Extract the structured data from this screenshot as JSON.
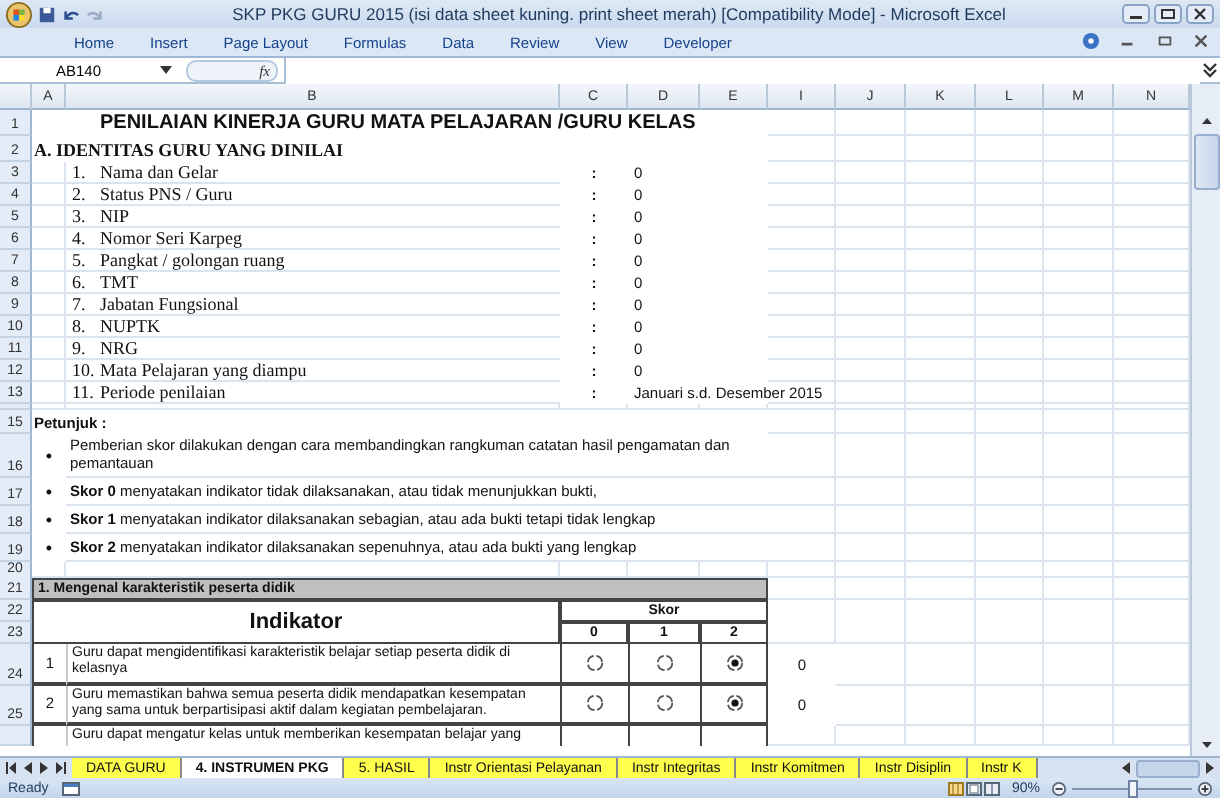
{
  "window": {
    "title": "SKP PKG GURU 2015 (isi data sheet kuning. print sheet merah)  [Compatibility Mode] - Microsoft Excel"
  },
  "ribbon_tabs": [
    "Home",
    "Insert",
    "Page Layout",
    "Formulas",
    "Data",
    "Review",
    "View",
    "Developer"
  ],
  "formula_bar": {
    "name_box": "AB140",
    "function_label": "fx"
  },
  "column_headers": [
    "A",
    "B",
    "C",
    "D",
    "E",
    "I",
    "J",
    "K",
    "L",
    "M",
    "N"
  ],
  "rows": [
    {
      "kind": "title",
      "row": "1",
      "text": "PENILAIAN KINERJA GURU MATA PELAJARAN /GURU KELAS"
    },
    {
      "kind": "section",
      "row": "2",
      "text": "A. IDENTITAS GURU YANG DINILAI"
    },
    {
      "kind": "field",
      "row": "3",
      "number": "1.",
      "label": "Nama dan Gelar",
      "colon": ":",
      "value": "0"
    },
    {
      "kind": "field",
      "row": "4",
      "number": "2.",
      "label": "Status PNS / Guru",
      "colon": ":",
      "value": "0"
    },
    {
      "kind": "field",
      "row": "5",
      "number": "3.",
      "label": "NIP",
      "colon": ":",
      "value": "0"
    },
    {
      "kind": "field",
      "row": "6",
      "number": "4.",
      "label": "Nomor Seri Karpeg",
      "colon": ":",
      "value": "0"
    },
    {
      "kind": "field",
      "row": "7",
      "number": "5.",
      "label": "Pangkat / golongan ruang",
      "colon": ":",
      "value": "0"
    },
    {
      "kind": "field",
      "row": "8",
      "number": "6.",
      "label": "TMT",
      "colon": ":",
      "value": "0"
    },
    {
      "kind": "field",
      "row": "9",
      "number": "7.",
      "label": "Jabatan Fungsional",
      "colon": ":",
      "value": "0"
    },
    {
      "kind": "field",
      "row": "10",
      "number": "8.",
      "label": "NUPTK",
      "colon": ":",
      "value": "0"
    },
    {
      "kind": "field",
      "row": "11",
      "number": "9.",
      "label": "NRG",
      "colon": ":",
      "value": "0"
    },
    {
      "kind": "field",
      "row": "12",
      "number": "10.",
      "label": "Mata Pelajaran yang diampu",
      "colon": ":",
      "value": "0"
    },
    {
      "kind": "field",
      "row": "13",
      "number": "11.",
      "label": "Periode penilaian",
      "colon": ":",
      "value": "Januari s.d. Desember 2015"
    },
    {
      "kind": "gap"
    },
    {
      "kind": "heading",
      "row": "15",
      "text": "Petunjuk :"
    },
    {
      "kind": "bullet",
      "row": "16",
      "bullet": "•",
      "text": "Pemberian skor dilakukan dengan cara membandingkan rangkuman catatan hasil pengamatan dan pemantauan"
    },
    {
      "kind": "bullet",
      "row": "17",
      "bullet": "•",
      "text": "**Skor 0** menyatakan indikator tidak dilaksanakan, atau tidak menunjukkan bukti,"
    },
    {
      "kind": "bullet",
      "row": "18",
      "bullet": "•",
      "text": "**Skor 1** menyatakan indikator dilaksanakan sebagian, atau ada bukti tetapi tidak lengkap"
    },
    {
      "kind": "bullet",
      "row": "19",
      "bullet": "•",
      "text": "**Skor 2** menyatakan indikator dilaksanakan sepenuhnya, atau ada bukti yang lengkap"
    },
    {
      "kind": "blank",
      "row": "20"
    },
    {
      "kind": "group",
      "row": "21",
      "text": "1. Mengenal karakteristik peserta didik"
    },
    {
      "kind": "table_header",
      "rows": [
        "22",
        "23"
      ],
      "indicator": "Indikator",
      "score": "Skor",
      "score_labels": [
        "0",
        "1",
        "2"
      ]
    },
    {
      "kind": "indicator",
      "row": "24",
      "number": "1",
      "text": "Guru dapat mengidentifikasi karakteristik belajar setiap peserta didik di kelasnya",
      "options": [
        {
          "selected": false
        },
        {
          "selected": false
        },
        {
          "selected": true
        }
      ],
      "result": "0"
    },
    {
      "kind": "indicator",
      "row": "25",
      "number": "2",
      "text": "Guru memastikan bahwa semua peserta didik mendapatkan kesempatan yang sama untuk berpartisipasi aktif dalam kegiatan pembelajaran.",
      "options": [
        {
          "selected": false
        },
        {
          "selected": false
        },
        {
          "selected": true
        }
      ],
      "result": "0"
    },
    {
      "kind": "indicator",
      "text": "Guru dapat mengatur kelas untuk memberikan kesempatan belajar yang"
    }
  ],
  "sheet_tabs": [
    {
      "label": "DATA GURU",
      "selected": false
    },
    {
      "label": "4. INSTRUMEN PKG",
      "selected": true
    },
    {
      "label": "5. HASIL",
      "selected": false
    },
    {
      "label": "Instr Orientasi Pelayanan",
      "selected": false
    },
    {
      "label": "Instr Integritas",
      "selected": false
    },
    {
      "label": "Instr Komitmen",
      "selected": false
    },
    {
      "label": "Instr Disiplin",
      "selected": false
    },
    {
      "label": "Instr K",
      "selected": false
    }
  ],
  "status_bar": {
    "status": "Ready",
    "zoom": "90%",
    "zoom_slider": {
      "level": 0.5
    }
  }
}
